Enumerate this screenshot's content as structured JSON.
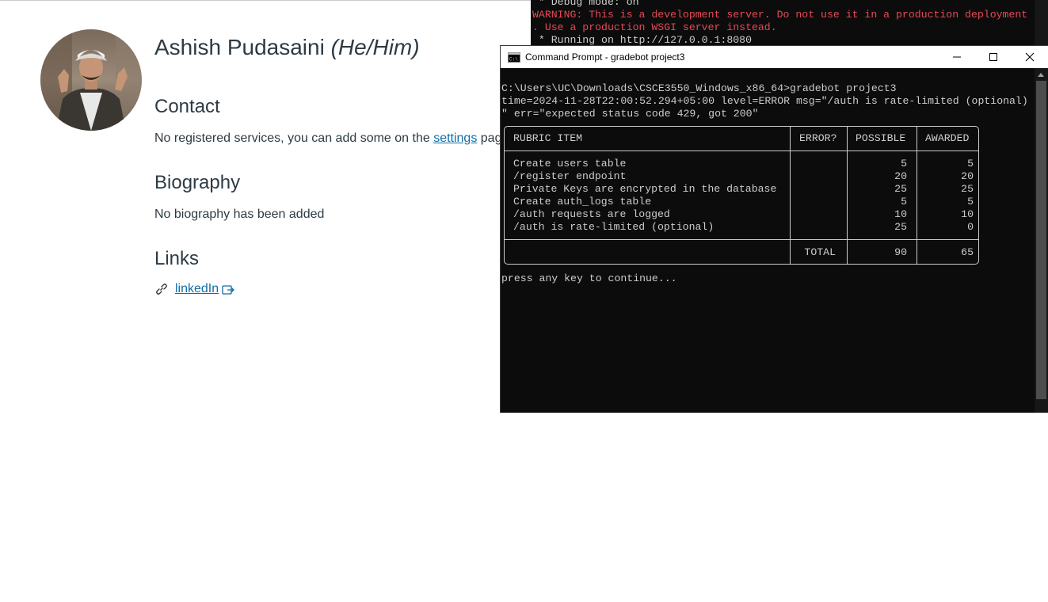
{
  "profile": {
    "name": "Ashish Pudasaini",
    "pronouns": "(He/Him)",
    "contact_heading": "Contact",
    "contact_text_before": "No registered services, you can add some on the ",
    "contact_link": "settings",
    "contact_text_after": " page.",
    "bio_heading": "Biography",
    "bio_text": "No biography has been added",
    "links_heading": "Links",
    "link_label": "linkedIn"
  },
  "background_terminal": {
    "line1": " * Debug mode: on",
    "line2": "WARNING: This is a development server. Do not use it in a production deployment",
    "line3": ". Use a production WSGI server instead.",
    "line4": " * Running on http://127.0.0.1:8080"
  },
  "cmd_window": {
    "title": "Command Prompt - gradebot  project3",
    "prompt_line": "C:\\Users\\UC\\Downloads\\CSCE3550_Windows_x86_64>gradebot project3",
    "log_line1": "time=2024-11-28T22:00:52.294+05:00 level=ERROR msg=\"/auth is rate-limited (optional)",
    "log_line2": "\" err=\"expected status code 429, got 200\"",
    "continue_text": "press any key to continue..."
  },
  "rubric": {
    "headers": [
      "RUBRIC ITEM",
      "ERROR?",
      "POSSIBLE",
      "AWARDED"
    ],
    "rows": [
      {
        "item": "Create users table",
        "error": "",
        "possible": "5",
        "awarded": "5"
      },
      {
        "item": "/register endpoint",
        "error": "",
        "possible": "20",
        "awarded": "20"
      },
      {
        "item": "Private Keys are encrypted in the database",
        "error": "",
        "possible": "25",
        "awarded": "25"
      },
      {
        "item": "Create auth_logs table",
        "error": "",
        "possible": "5",
        "awarded": "5"
      },
      {
        "item": "/auth requests are logged",
        "error": "",
        "possible": "10",
        "awarded": "10"
      },
      {
        "item": "/auth is rate-limited (optional)",
        "error": "",
        "possible": "25",
        "awarded": "0"
      }
    ],
    "total_label": "TOTAL",
    "total_possible": "90",
    "total_awarded": "65"
  },
  "colors": {
    "warning_red": "#e74856",
    "console_text": "#cccccc",
    "link_blue": "#0e6fa8"
  },
  "icons": [
    "link-icon",
    "external-link-icon",
    "cmd-app-icon",
    "minimize-icon",
    "maximize-icon",
    "close-icon"
  ]
}
